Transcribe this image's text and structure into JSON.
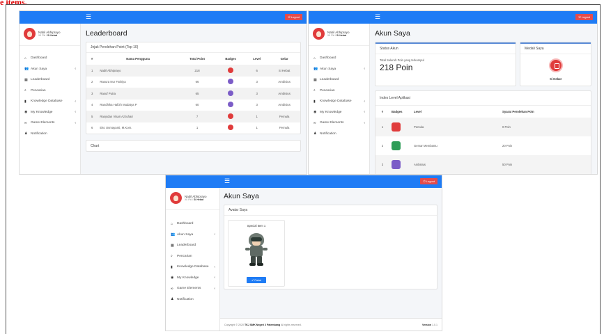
{
  "colors": {
    "topbar": "#1f7cf5",
    "logout": "#e44b4b",
    "accent_top": "#5a8bd8"
  },
  "header_text": "e items.",
  "topbar": {
    "menu_icon": "hamburger-icon",
    "logout_label": "Logout"
  },
  "user": {
    "name": "Nabil Abhiprayo",
    "role_prefix": "XII Pkl /",
    "role": "Si Hebat"
  },
  "sidebar": {
    "items": [
      {
        "label": "Dashboard",
        "icon": "home-icon"
      },
      {
        "label": "Akun Saya",
        "icon": "users-icon",
        "chevron": "‹"
      },
      {
        "label": "Leaderboard",
        "icon": "table-icon"
      },
      {
        "label": "Pencarian",
        "icon": "search-icon"
      },
      {
        "label": "Knowledge Database",
        "icon": "book-icon",
        "chevron": "‹"
      },
      {
        "label": "My Knowledge",
        "icon": "gauge-icon",
        "chevron": "‹"
      },
      {
        "label": "Game Elements",
        "icon": "gamepad-icon",
        "chevron": "‹"
      },
      {
        "label": "Notification",
        "icon": "bell-icon"
      }
    ]
  },
  "leaderboard": {
    "title": "Leaderboard",
    "card_title": "Jejak Perolehan Point (Top 10)",
    "columns": [
      "#",
      "Nama Pengguna",
      "Total Point",
      "Badges",
      "Level",
      "Gelar"
    ],
    "rows": [
      {
        "rank": "1",
        "name": "Nabil Abhiprayo",
        "points": "218",
        "badge_color": "#e03b3b",
        "level": "6",
        "title": "Si Hebat"
      },
      {
        "rank": "2",
        "name": "Rasura Nur Fathiya",
        "points": "66",
        "badge_color": "#7b5cc7",
        "level": "3",
        "title": "Ambisius"
      },
      {
        "rank": "3",
        "name": "Rasuf Putra",
        "points": "65",
        "badge_color": "#7b5cc7",
        "level": "3",
        "title": "Ambisius"
      },
      {
        "rank": "4",
        "name": "Randhika Hafizh Mudatya P",
        "points": "60",
        "badge_color": "#7b5cc7",
        "level": "3",
        "title": "Ambisius"
      },
      {
        "rank": "5",
        "name": "Rasyidan Visari Azzuhari",
        "points": "7",
        "badge_color": "#e03b3b",
        "level": "1",
        "title": "Pemula"
      },
      {
        "rank": "6",
        "name": "Eko Usmayanti, M.Kom.",
        "points": "1",
        "badge_color": "#e03b3b",
        "level": "1",
        "title": "Pemula"
      }
    ],
    "chart_card_title": "Chart"
  },
  "akun": {
    "title": "Akun Saya",
    "status_title": "Status Akun",
    "points_label": "Total Seluruh Poin yang terkumpul",
    "points_value": "218 Poin",
    "medal_title": "Medali Saya",
    "medal_icon": "medal-icon",
    "medal_name": "Si Hebat",
    "index_title": "Index Level Aplikasi",
    "columns": [
      "#",
      "Badges",
      "Level",
      "Syarat Perolehan Poin"
    ],
    "levels": [
      {
        "num": "1",
        "badge_color": "#e03b3b",
        "level": "Pemula",
        "req": "0 Poin"
      },
      {
        "num": "2",
        "badge_color": "#2e9c57",
        "level": "Gemar Membantu",
        "req": "20 Poin"
      },
      {
        "num": "3",
        "badge_color": "#7b5cc7",
        "level": "Ambisius",
        "req": "50 Poin"
      }
    ]
  },
  "avatar_page": {
    "title": "Akun Saya",
    "card_title": "Avatar Saya",
    "item_title": "Special Item 1",
    "use_label": "✔ Pakai",
    "footer_prefix": "Copyright © 2020",
    "footer_org": "TKJ SMK Negeri 2 Palembang",
    "footer_suffix": "All rights reserved.",
    "footer_version_label": "Version",
    "footer_version": "1.0.1"
  }
}
